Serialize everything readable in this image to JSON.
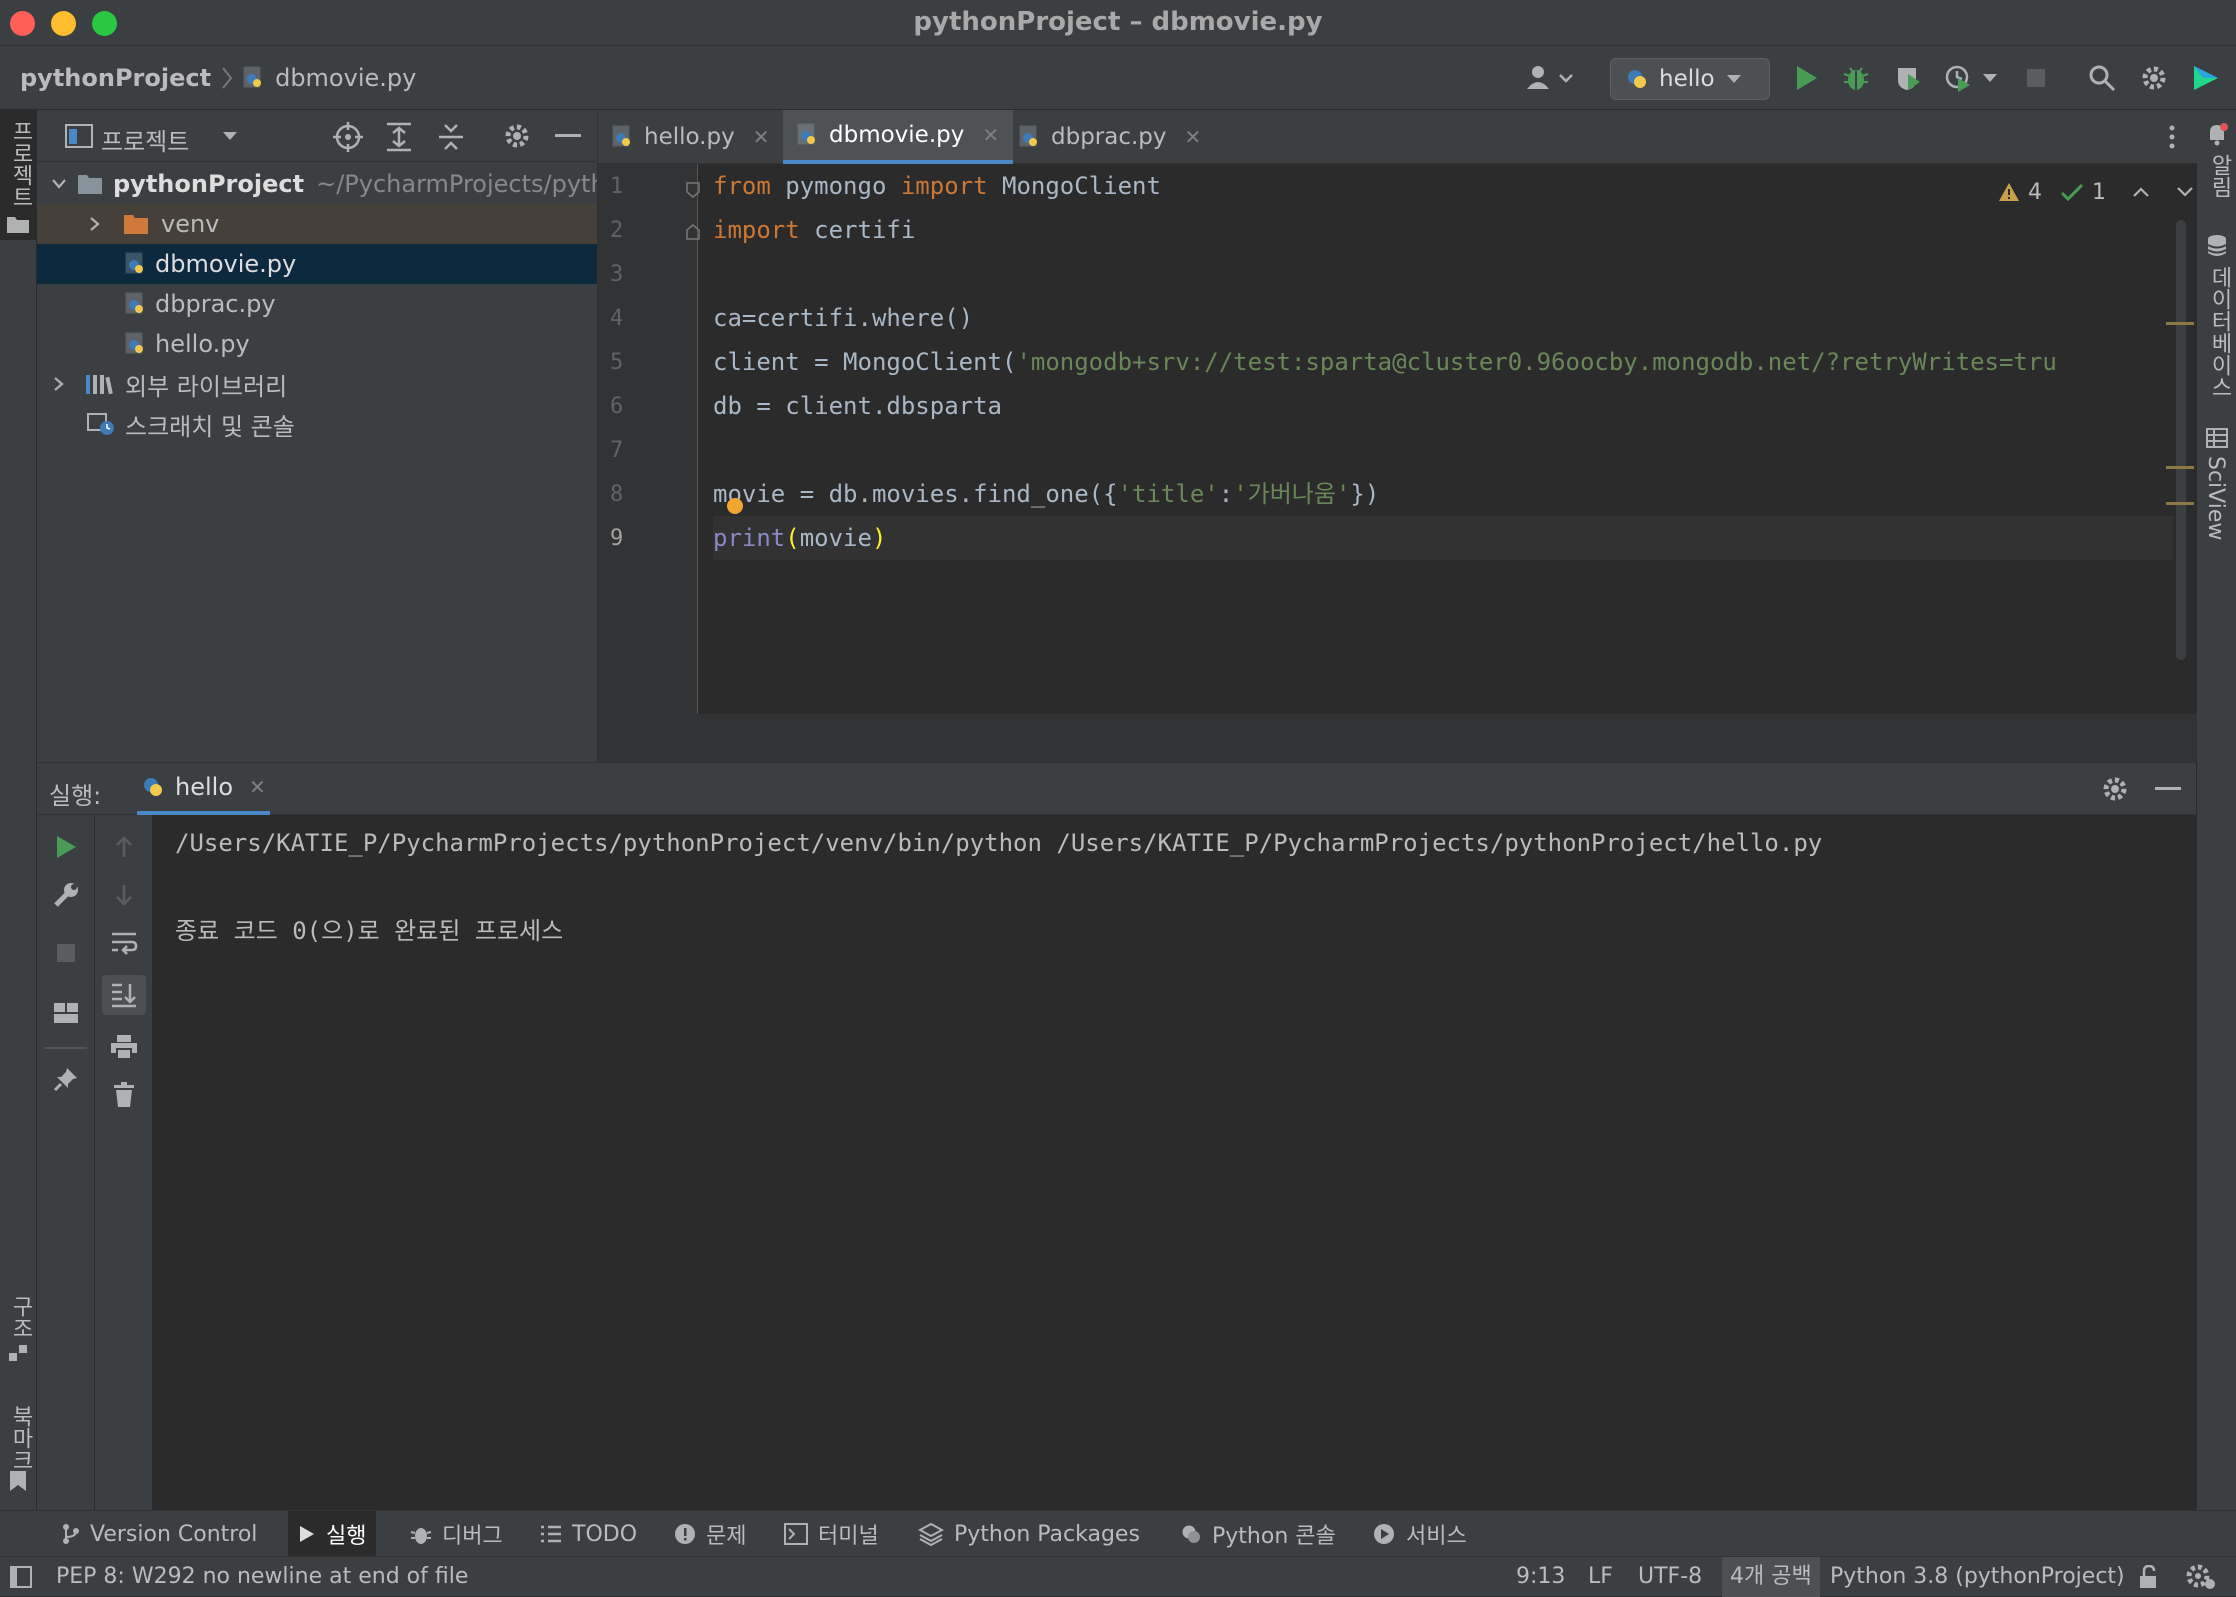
{
  "window": {
    "title": "pythonProject – dbmovie.py",
    "traffic_lights": {
      "close": "#ff5f57",
      "minimize": "#febc2e",
      "maximize": "#28c840"
    }
  },
  "navbar": {
    "project": "pythonProject",
    "file": "dbmovie.py",
    "run_config": "hello"
  },
  "left_strip": {
    "project_label": "프로젝트",
    "structure_label": "구조",
    "bookmarks_label": "북마크"
  },
  "right_strip": {
    "notifications_label": "알림",
    "database_label": "데이터베이스",
    "sciview_label": "SciView"
  },
  "project_panel": {
    "title": "프로젝트",
    "tree": [
      {
        "name": "pythonProject",
        "path": "~/PycharmProjects/pyth",
        "type": "project",
        "expanded": true
      },
      {
        "name": "venv",
        "type": "folder",
        "expanded": false
      },
      {
        "name": "dbmovie.py",
        "type": "python",
        "selected": true
      },
      {
        "name": "dbprac.py",
        "type": "python"
      },
      {
        "name": "hello.py",
        "type": "python"
      },
      {
        "name": "외부 라이브러리",
        "type": "library",
        "expanded": false
      },
      {
        "name": "스크래치 및 콘솔",
        "type": "scratch"
      }
    ]
  },
  "editor": {
    "tabs": [
      {
        "label": "hello.py",
        "active": false
      },
      {
        "label": "dbmovie.py",
        "active": true
      },
      {
        "label": "dbprac.py",
        "active": false
      }
    ],
    "inspections": {
      "warnings": "4",
      "weak_warnings": "1"
    },
    "line_numbers": [
      "1",
      "2",
      "3",
      "4",
      "5",
      "6",
      "7",
      "8",
      "9"
    ],
    "code_lines": [
      "from pymongo import MongoClient",
      "import certifi",
      "",
      "ca=certifi.where()",
      "client = MongoClient('mongodb+srv://test:sparta@cluster0.96oocby.mongodb.net/?retryWrites=tru",
      "db = client.dbsparta",
      "",
      "movie = db.movies.find_one({'title':'가버나움'})",
      "print(movie)"
    ]
  },
  "run_panel": {
    "label": "실행:",
    "tab": "hello",
    "output": [
      "/Users/KATIE_P/PycharmProjects/pythonProject/venv/bin/python /Users/KATIE_P/PycharmProjects/pythonProject/hello.py",
      "",
      "종료 코드 0(으)로 완료된 프로세스"
    ]
  },
  "bottom_tools": [
    {
      "label": "Version Control",
      "icon": "branch-icon",
      "active": false
    },
    {
      "label": "실행",
      "icon": "play-icon",
      "active": true
    },
    {
      "label": "디버그",
      "icon": "bug-icon",
      "active": false
    },
    {
      "label": "TODO",
      "icon": "list-icon",
      "active": false
    },
    {
      "label": "문제",
      "icon": "alert-icon",
      "active": false
    },
    {
      "label": "터미널",
      "icon": "terminal-icon",
      "active": false
    },
    {
      "label": "Python Packages",
      "icon": "layers-icon",
      "active": false
    },
    {
      "label": "Python 콘솔",
      "icon": "python-icon",
      "active": false
    },
    {
      "label": "서비스",
      "icon": "services-icon",
      "active": false
    }
  ],
  "status_bar": {
    "message": "PEP 8: W292 no newline at end of file",
    "position": "9:13",
    "line_sep": "LF",
    "encoding": "UTF-8",
    "indent": "4개 공백",
    "interpreter": "Python 3.8 (pythonProject)"
  }
}
